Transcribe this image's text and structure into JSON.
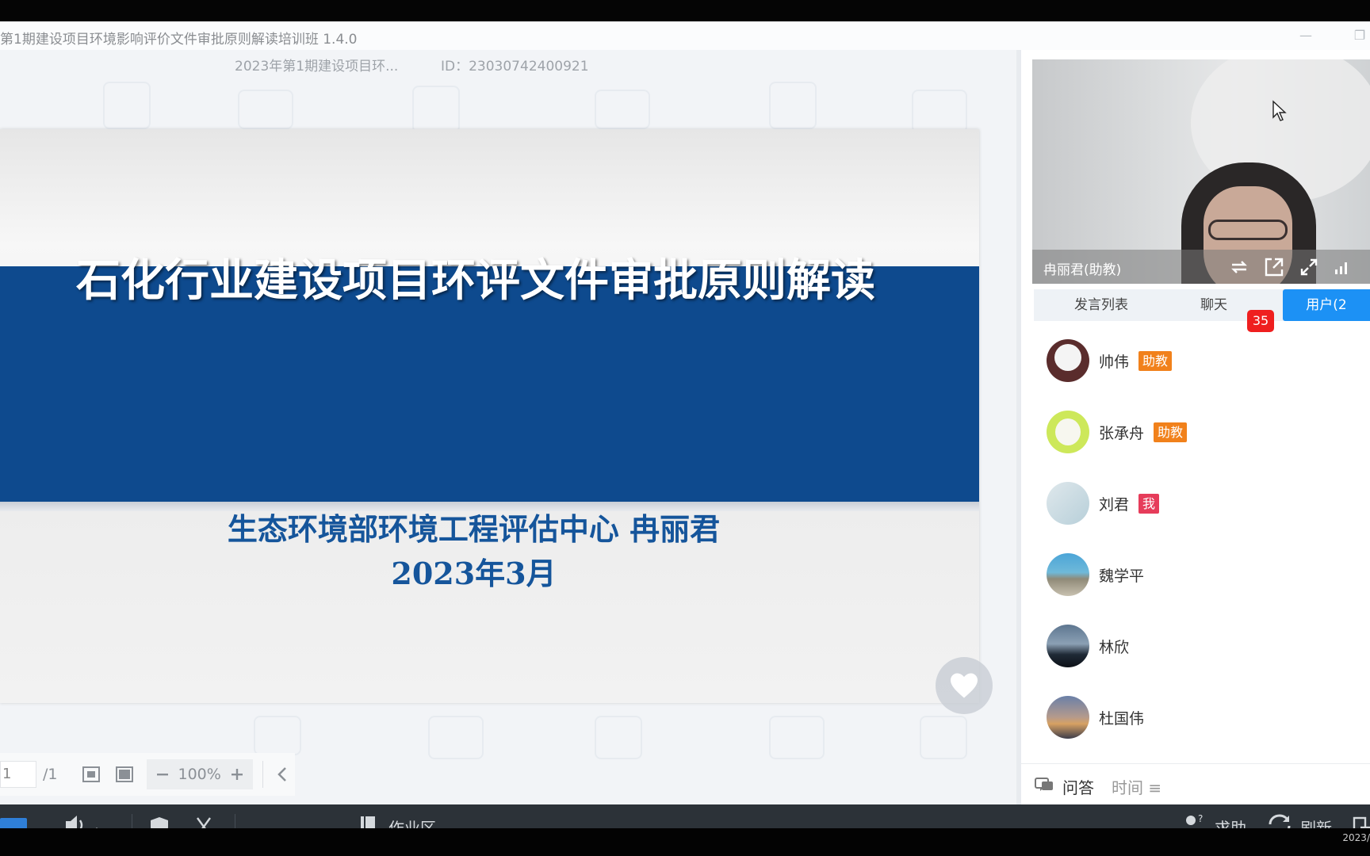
{
  "window": {
    "title": "第1期建设项目环境影响评价文件审批原则解读培训班 1.4.0",
    "minimize_glyph": "—",
    "restore_glyph": "❐"
  },
  "session": {
    "name": "2023年第1期建设项目环...",
    "id_text": "ID：23030742400921"
  },
  "slide": {
    "title": "石化行业建设项目环评文件审批原则解读",
    "organization": "生态环境部环境工程评估中心  冉丽君",
    "date": "2023年3月",
    "band_color": "#0e4a8e"
  },
  "slide_toolbar": {
    "page_current": "1",
    "page_total": "/1",
    "zoom": "100%",
    "icons": [
      "fit-page-icon",
      "fit-width-icon",
      "zoom-out-icon",
      "zoom-in-icon",
      "collapse-left-icon"
    ]
  },
  "video": {
    "presenter": "冉丽君(助教)",
    "icons": [
      "switch-camera-icon",
      "popout-icon",
      "fullscreen-icon",
      "signal-icon"
    ]
  },
  "tabs": [
    {
      "label": "发言列表",
      "active": false
    },
    {
      "label": "聊天",
      "active": false,
      "badge": "35"
    },
    {
      "label": "用户(2",
      "active": true
    }
  ],
  "users": [
    {
      "name": "帅伟",
      "role": "助教",
      "role_type": "assist"
    },
    {
      "name": "张承舟",
      "role": "助教",
      "role_type": "assist"
    },
    {
      "name": "刘君",
      "role": "我",
      "role_type": "me"
    },
    {
      "name": "魏学平",
      "role": ""
    },
    {
      "name": "林欣",
      "role": ""
    },
    {
      "name": "杜国伟",
      "role": ""
    }
  ],
  "qa": {
    "label": "问答",
    "time": "时间 ≡"
  },
  "bottombar": {
    "workspace": "作业区",
    "help": "求助",
    "refresh": "刷新",
    "icons": [
      "app-logo-icon",
      "volume-icon",
      "shield-icon",
      "scissors-icon",
      "book-icon",
      "help-user-icon",
      "refresh-icon",
      "exit-icon"
    ]
  },
  "clock": "2023/",
  "colors": {
    "accent": "#1c91f5",
    "badge": "#ef1f1f",
    "assist_tag": "#f1811b",
    "me_tag": "#e63c5a",
    "bottombar": "#2c3238"
  }
}
